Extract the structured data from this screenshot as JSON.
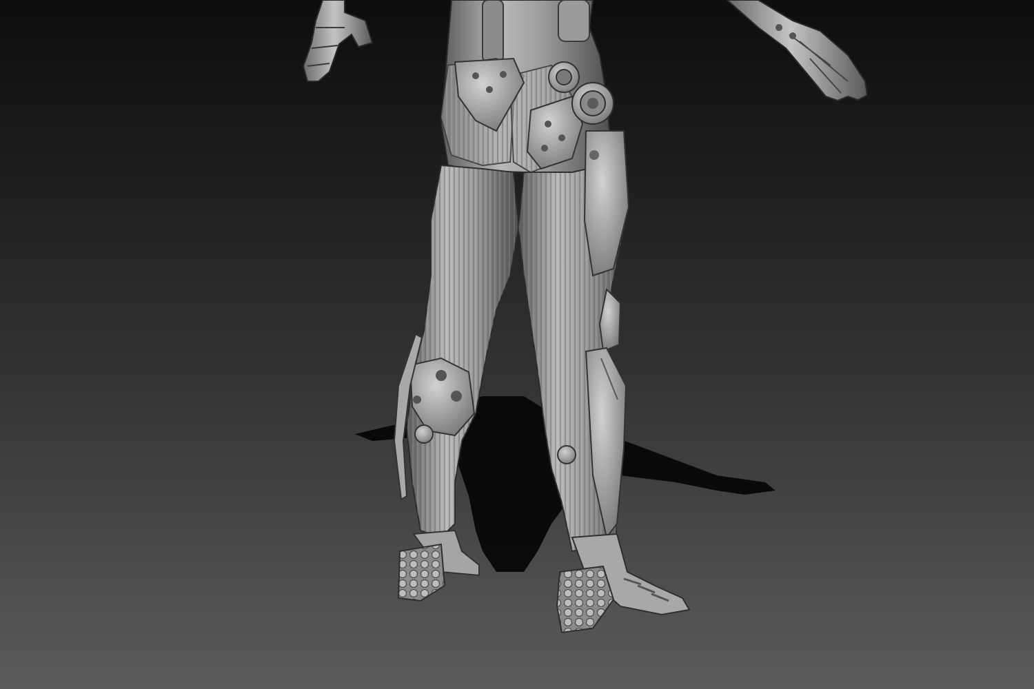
{
  "scene": {
    "subject": "sculpt-render",
    "colors": {
      "background_top": "#0d0d0d",
      "background_bottom": "#5c5c5c",
      "sculpt_light": "#c9c9c9",
      "sculpt_mid": "#9a9a9a",
      "sculpt_dark": "#4a4a4a",
      "shadow": "#050505"
    }
  }
}
